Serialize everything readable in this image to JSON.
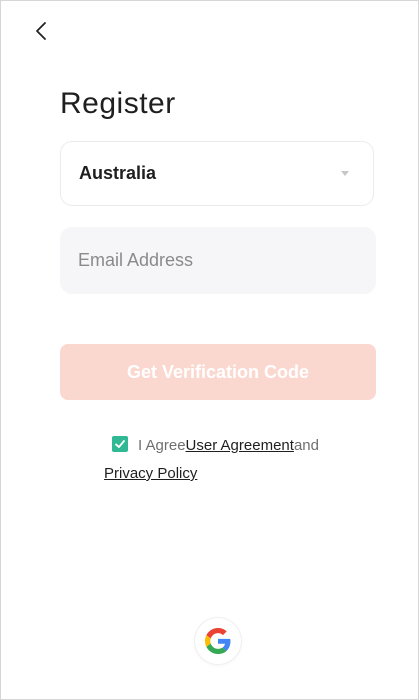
{
  "header": {
    "back_icon": "chevron-left-icon",
    "title": "Register"
  },
  "form": {
    "country": {
      "value": "Australia",
      "icon": "caret-down-icon"
    },
    "email": {
      "value": "",
      "placeholder": "Email Address"
    },
    "submit_label": "Get Verification Code",
    "submit_color": "#fbd8cf"
  },
  "agreement": {
    "checked": true,
    "checkbox_color": "#2fb893",
    "prefix": "I Agree",
    "user_agreement_link": "User Agreement",
    "conjunction": "and",
    "privacy_policy_link": "Privacy Policy"
  },
  "social_login": {
    "google_icon": "google-icon"
  }
}
